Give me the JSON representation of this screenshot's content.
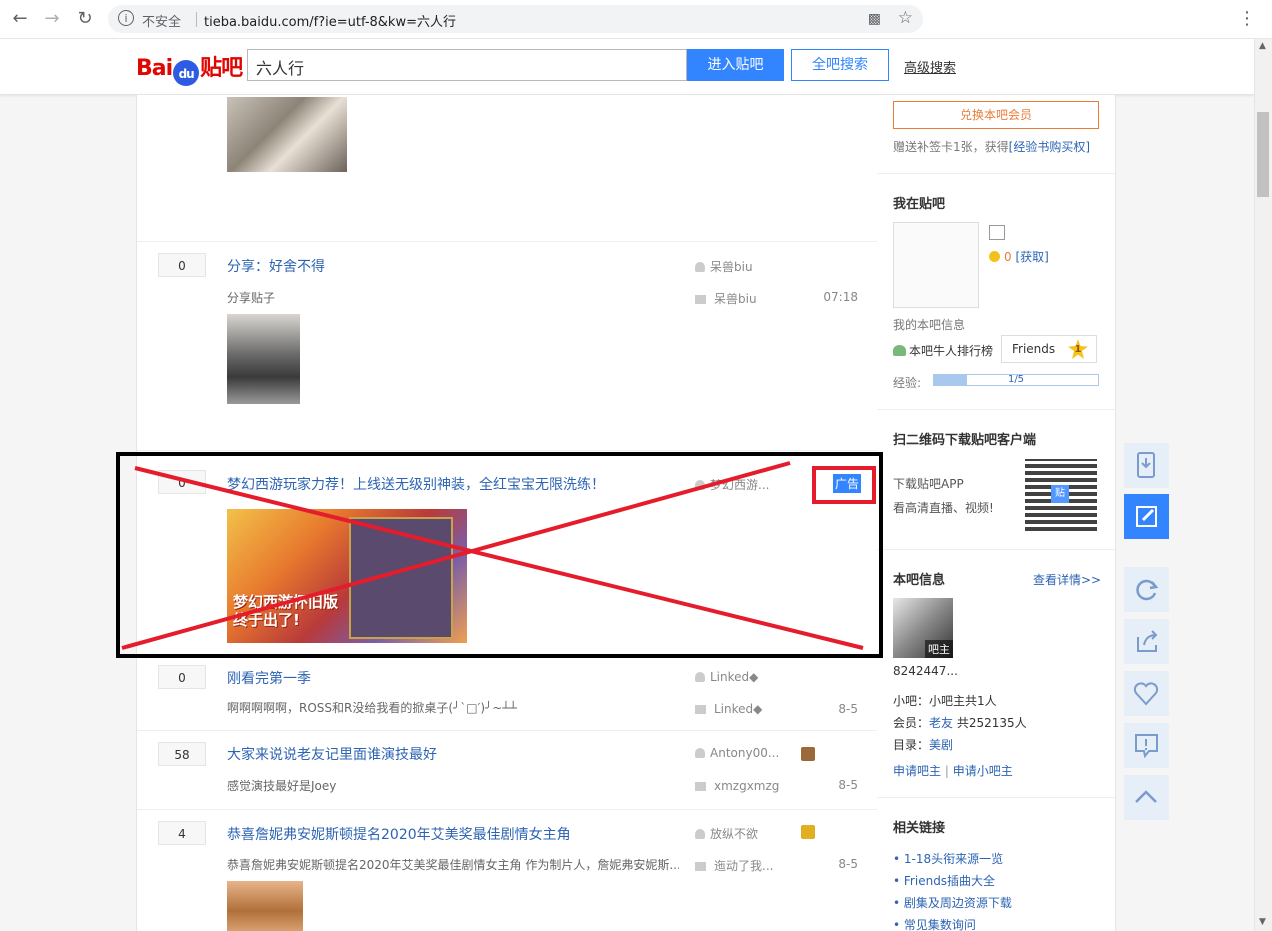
{
  "browser": {
    "security_label": "不安全",
    "url": "tieba.baidu.com/f?ie=utf-8&kw=六人行"
  },
  "header": {
    "logo_text_left": "Bai",
    "logo_paw": "du",
    "logo_text_right": "贴吧",
    "search_value": "六人行",
    "enter_button": "进入贴吧",
    "all_search_button": "全吧搜索",
    "advanced_link": "高级搜索"
  },
  "threads": [
    {
      "replies": "0",
      "title": "分享：好舍不得",
      "brief": "分享贴子",
      "author": "呆兽biu",
      "last_reply": "呆兽biu",
      "time": "07:18"
    },
    {
      "replies": "0",
      "title": "梦幻西游玩家力荐！上线送无级别神装，全红宝宝无限洗练！",
      "author": "梦幻西游...",
      "ad_label": "广告",
      "ad_image_text": "梦幻西游怀旧版 终于出了!"
    },
    {
      "replies": "0",
      "title": "刚看完第一季",
      "brief": "啊啊啊啊啊，ROSS和R没给我看的掀桌子(╯`□′)╯~┴┴",
      "author": "Linked◆",
      "last_reply": "Linked◆",
      "time": "8-5"
    },
    {
      "replies": "58",
      "title": "大家来说说老友记里面谁演技最好",
      "brief": "感觉演技最好是Joey",
      "author": "Antony00...",
      "last_reply": "xmzgxmzg",
      "time": "8-5"
    },
    {
      "replies": "4",
      "title": "恭喜詹妮弗安妮斯顿提名2020年艾美奖最佳剧情女主角",
      "brief": "恭喜詹妮弗安妮斯顿提名2020年艾美奖最佳剧情女主角 作为制片人，詹妮弗安妮斯...",
      "author": "放纵不欲",
      "last_reply": "迤动了我...",
      "time": "8-5"
    }
  ],
  "sidebar": {
    "member_button": "兑换本吧会员",
    "member_note": "赠送补签卡1张，获得",
    "member_note_link": "[经验书购买权]",
    "my_tieba": {
      "title": "我在贴吧",
      "coins": "0",
      "get_link": "[获取]",
      "info_label": "我的本吧信息",
      "rank_label": "本吧牛人排行榜",
      "level_name": "Friends",
      "level_num": "1",
      "exp_label": "经验:",
      "exp_value": "1/5",
      "exp_fraction": 0.2
    },
    "app": {
      "title": "扫二维码下载贴吧客户端",
      "line1": "下载贴吧APP",
      "line2": "看高清直播、视频!",
      "qr_badge": "贴"
    },
    "bar_info": {
      "title": "本吧信息",
      "details_link": "查看详情>>",
      "owner_badge": "吧主",
      "owner_id": "8242447...",
      "small_owner_label": "小吧：",
      "small_owner_value": "小吧主共1人",
      "members_label": "会员：",
      "members_link": "老友",
      "members_value": "共252135人",
      "dir_label": "目录：",
      "dir_link": "美剧",
      "apply_owner": "申请吧主",
      "divider": "|",
      "apply_small_owner": "申请小吧主"
    },
    "related": {
      "title": "相关链接",
      "links": [
        "1-18头衔来源一览",
        "Friends插曲大全",
        "剧集及周边资源下载",
        "常见集数询问"
      ]
    }
  },
  "colors": {
    "brand_blue": "#3385ff",
    "link_blue": "#2d64b3",
    "member_orange": "#e87d3a",
    "annotation_red": "#e41c2c"
  }
}
